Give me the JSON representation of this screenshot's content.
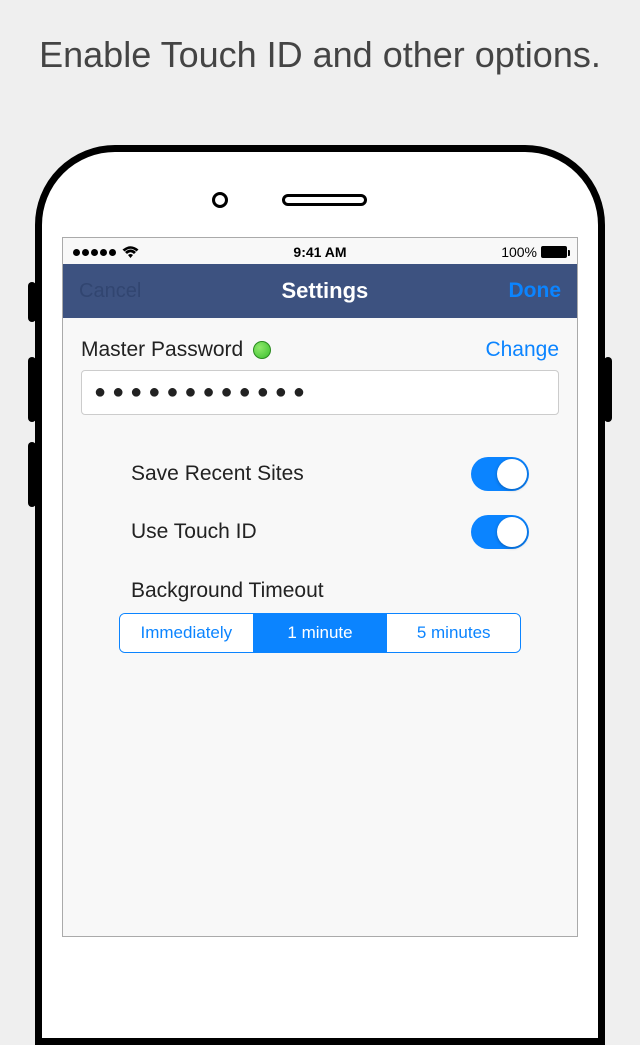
{
  "caption": "Enable Touch ID and other options.",
  "statusBar": {
    "time": "9:41 AM",
    "battery": "100%"
  },
  "nav": {
    "cancel": "Cancel",
    "title": "Settings",
    "done": "Done"
  },
  "masterPassword": {
    "label": "Master Password",
    "changeLabel": "Change",
    "masked": "●●●●●●●●●●●●"
  },
  "options": {
    "saveRecent": {
      "label": "Save Recent Sites",
      "on": true
    },
    "touchId": {
      "label": "Use Touch ID",
      "on": true
    }
  },
  "timeout": {
    "label": "Background Timeout",
    "segments": [
      "Immediately",
      "1 minute",
      "5 minutes"
    ],
    "selectedIndex": 1
  }
}
